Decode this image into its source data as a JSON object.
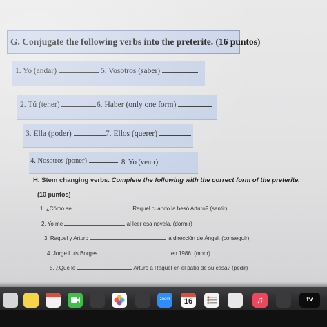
{
  "worksheet": {
    "section_g": {
      "title": "G. Conjugate the following verbs into the preterite. (16 puntos)",
      "rows": [
        {
          "left": "1. Yo (andar)",
          "right": "5. Vosotros (saber)"
        },
        {
          "left": "2. Tú (tener)",
          "right": "6. Haber (only one form)"
        },
        {
          "left": "3. Ella (poder)",
          "right": "7. Ellos (querer)"
        },
        {
          "left": "4. Nosotros (poner)",
          "right": "8. Yo (venir)"
        }
      ]
    },
    "section_h": {
      "title_bold": "H. Stem changing verbs.",
      "title_italic": "Complete the following with the correct form of the preterite.",
      "points": "(10 puntos)",
      "items": [
        {
          "before": "1. ¿Cómo se",
          "after": "Raquel cuando la besó Arturo? (sentir)"
        },
        {
          "before": "2. Yo me",
          "after": "al leer esa novela. (dormir)"
        },
        {
          "before": "3. Raquel y Arturo",
          "after": "la dirección de Ángel. (conseguir)"
        },
        {
          "before": "4. Jorge Luis Borges",
          "after": "en 1986. (morir)"
        },
        {
          "before": "5. ¿Qué le",
          "after": "Arturo a Raquel en el patio de su casa? (pedir)"
        }
      ]
    }
  },
  "dock": {
    "calendar_day": "16",
    "tv_label": "tv",
    "zoom_label": "zoom",
    "icons": [
      "photos-icon",
      "facetime-icon",
      "calendar-icon",
      "music-icon",
      "apple-tv-icon"
    ]
  },
  "colors": {
    "box_fill": "#c8d3e8",
    "header_fill": "#ccd6ea",
    "music_red": "#f0455a"
  }
}
